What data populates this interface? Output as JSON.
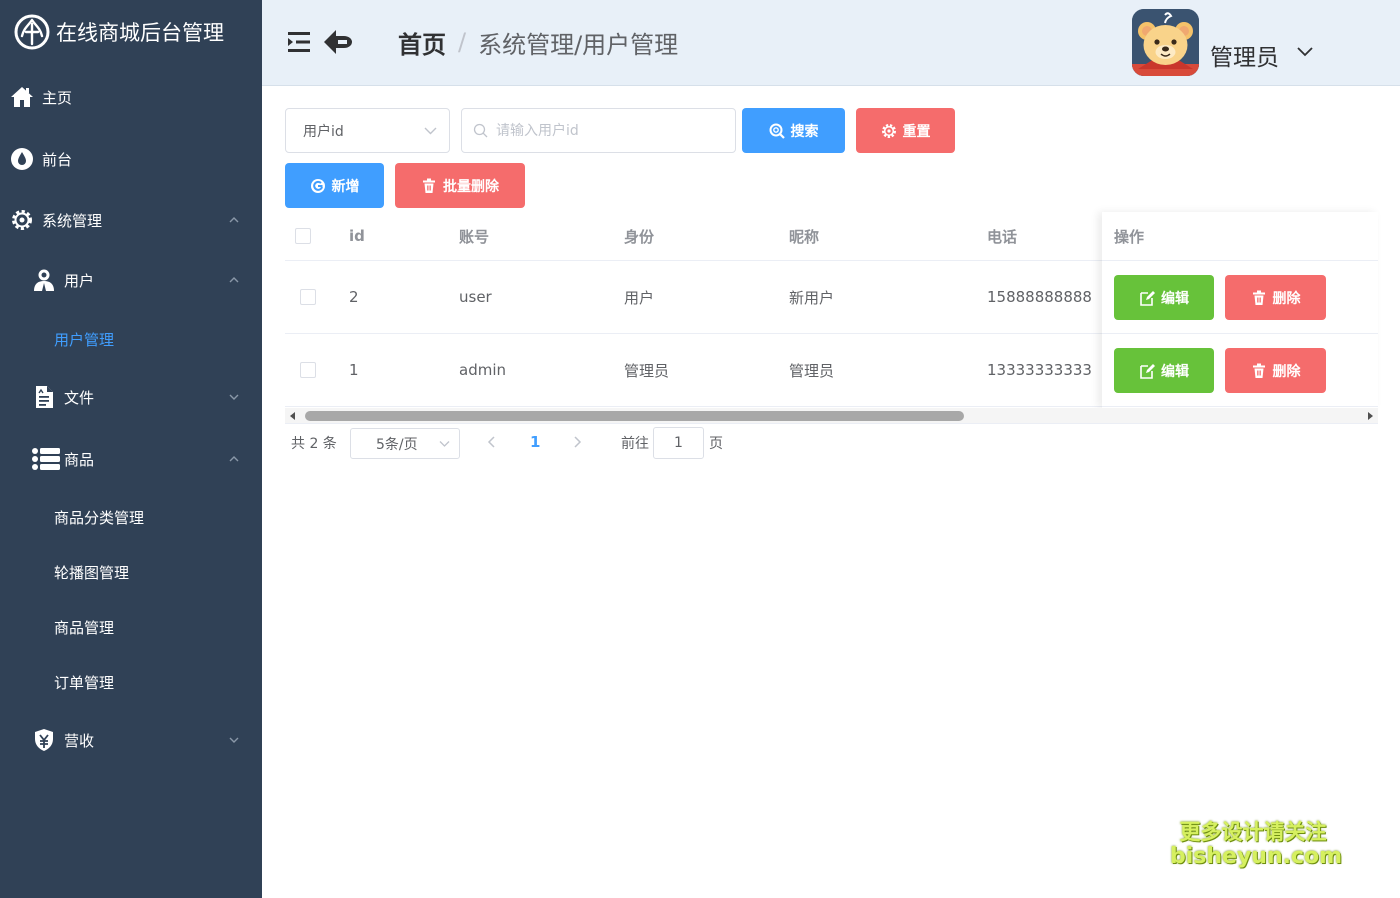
{
  "app": {
    "title": "在线商城后台管理"
  },
  "sidebar": {
    "items": [
      {
        "label": "主页",
        "icon": "home-icon"
      },
      {
        "label": "前台",
        "icon": "drop-icon"
      },
      {
        "label": "系统管理",
        "icon": "gear-icon",
        "expanded": true
      },
      {
        "label": "用户",
        "icon": "user-icon",
        "expanded": true
      },
      {
        "label": "用户管理",
        "active": true
      },
      {
        "label": "文件",
        "icon": "file-icon",
        "expanded": false
      },
      {
        "label": "商品",
        "icon": "list-icon",
        "expanded": true
      },
      {
        "label": "商品分类管理"
      },
      {
        "label": "轮播图管理"
      },
      {
        "label": "商品管理"
      },
      {
        "label": "订单管理"
      },
      {
        "label": "营收",
        "icon": "shield-money-icon",
        "expanded": false
      }
    ]
  },
  "header": {
    "breadcrumb": {
      "home": "首页",
      "separator": "/",
      "current": "系统管理/用户管理"
    },
    "user": {
      "name": "管理员"
    }
  },
  "toolbar": {
    "field_select_value": "用户id",
    "search_placeholder": "请输入用户id",
    "search_label": "搜索",
    "reset_label": "重置",
    "add_label": "新增",
    "batch_delete_label": "批量删除"
  },
  "table": {
    "columns": [
      "id",
      "账号",
      "身份",
      "昵称",
      "电话",
      "操作"
    ],
    "rows": [
      {
        "id": "2",
        "account": "user",
        "role": "用户",
        "nickname": "新用户",
        "phone": "15888888888"
      },
      {
        "id": "1",
        "account": "admin",
        "role": "管理员",
        "nickname": "管理员",
        "phone": "13333333333"
      }
    ],
    "edit_label": "编辑",
    "delete_label": "删除"
  },
  "pagination": {
    "total_text": "共 2 条",
    "page_size": "5条/页",
    "current_page": "1",
    "goto_label": "前往",
    "goto_value": "1",
    "goto_suffix": "页"
  },
  "watermark": {
    "line1": "更多设计请关注",
    "line2": "bisheyun.com"
  },
  "colors": {
    "sidebar_bg": "#304156",
    "header_bg": "#e8f0f8",
    "primary": "#409eff",
    "danger": "#f56c6c",
    "success": "#67c23a"
  }
}
